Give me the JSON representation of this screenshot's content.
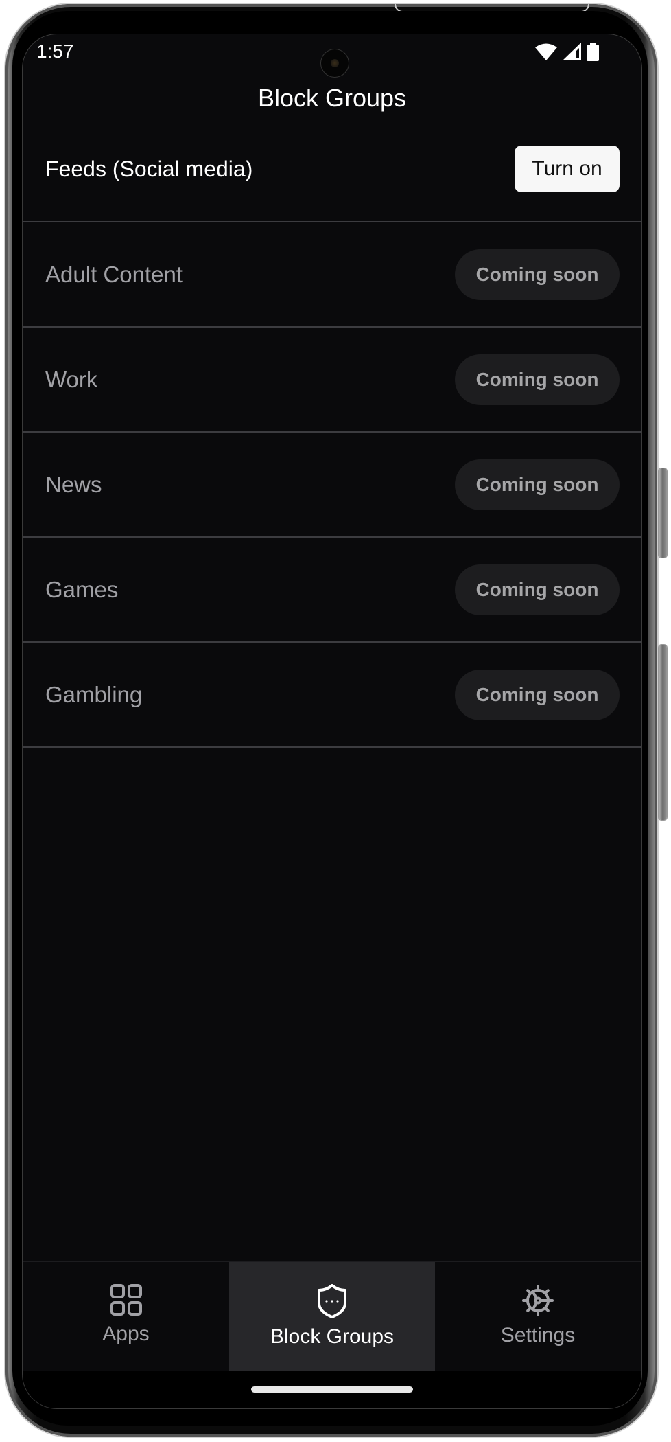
{
  "status_bar": {
    "time": "1:57",
    "icons": [
      "wifi-icon",
      "cellular-signal-icon",
      "battery-icon"
    ]
  },
  "header": {
    "title": "Block Groups"
  },
  "groups": [
    {
      "name": "Feeds (Social media)",
      "action": "Turn on",
      "enabled": true
    },
    {
      "name": "Adult Content",
      "action": "Coming soon",
      "enabled": false
    },
    {
      "name": "Work",
      "action": "Coming soon",
      "enabled": false
    },
    {
      "name": "News",
      "action": "Coming soon",
      "enabled": false
    },
    {
      "name": "Games",
      "action": "Coming soon",
      "enabled": false
    },
    {
      "name": "Gambling",
      "action": "Coming soon",
      "enabled": false
    }
  ],
  "bottom_nav": {
    "items": [
      {
        "label": "Apps",
        "icon": "apps-grid-icon",
        "active": false
      },
      {
        "label": "Block Groups",
        "icon": "shield-icon",
        "active": true
      },
      {
        "label": "Settings",
        "icon": "gear-icon",
        "active": false
      }
    ]
  },
  "colors": {
    "background": "#0a0a0c",
    "active_tab": "#27272a",
    "primary_button": "#f7f7f7",
    "pill": "#1d1d1f",
    "muted_text": "#a1a1a6"
  }
}
